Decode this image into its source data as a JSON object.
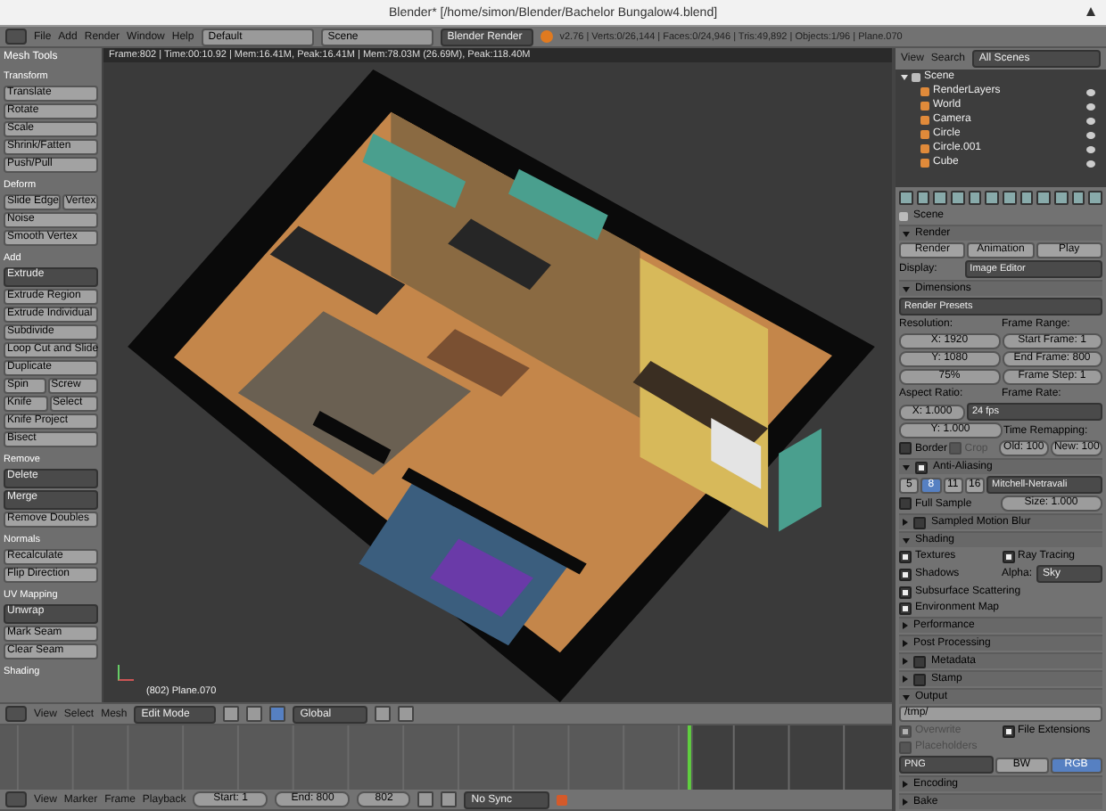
{
  "window": {
    "title": "Blender* [/home/simon/Blender/Bachelor Bungalow4.blend]"
  },
  "top_header": {
    "menus": [
      "File",
      "Add",
      "Render",
      "Window",
      "Help"
    ],
    "layout": "Default",
    "scene": "Scene",
    "engine": "Blender Render",
    "stats": "v2.76 | Verts:0/26,144 | Faces:0/24,946 | Tris:49,892 | Objects:1/96 | Plane.070"
  },
  "tool_shelf": {
    "title": "Mesh Tools",
    "sections": [
      {
        "title": "Transform",
        "rows": [
          [
            {
              "kind": "action",
              "text": "Translate"
            }
          ],
          [
            {
              "kind": "action",
              "text": "Rotate"
            }
          ],
          [
            {
              "kind": "action",
              "text": "Scale"
            }
          ],
          [
            {
              "kind": "action",
              "text": "Shrink/Fatten"
            }
          ],
          [
            {
              "kind": "action",
              "text": "Push/Pull"
            }
          ]
        ]
      },
      {
        "title": "Deform",
        "rows": [
          [
            {
              "kind": "action",
              "text": "Slide Edge"
            },
            {
              "kind": "action",
              "text": "Vertex"
            }
          ],
          [
            {
              "kind": "action",
              "text": "Noise"
            }
          ],
          [
            {
              "kind": "action",
              "text": "Smooth Vertex"
            }
          ]
        ]
      },
      {
        "title": "Add",
        "rows": [
          [
            {
              "kind": "dropdown",
              "text": "Extrude"
            }
          ],
          [
            {
              "kind": "action",
              "text": "Extrude Region"
            }
          ],
          [
            {
              "kind": "action",
              "text": "Extrude Individual"
            }
          ],
          [
            {
              "kind": "action",
              "text": "Subdivide"
            }
          ],
          [
            {
              "kind": "action",
              "text": "Loop Cut and Slide"
            }
          ],
          [
            {
              "kind": "action",
              "text": "Duplicate"
            }
          ],
          [
            {
              "kind": "action",
              "text": "Spin"
            },
            {
              "kind": "action",
              "text": "Screw"
            }
          ],
          [
            {
              "kind": "action",
              "text": "Knife"
            },
            {
              "kind": "action",
              "text": "Select"
            }
          ],
          [
            {
              "kind": "action",
              "text": "Knife Project"
            }
          ],
          [
            {
              "kind": "action",
              "text": "Bisect"
            }
          ]
        ]
      },
      {
        "title": "Remove",
        "rows": [
          [
            {
              "kind": "dropdown",
              "text": "Delete"
            }
          ],
          [
            {
              "kind": "dropdown",
              "text": "Merge"
            }
          ],
          [
            {
              "kind": "action",
              "text": "Remove Doubles"
            }
          ]
        ]
      },
      {
        "title": "Normals",
        "rows": [
          [
            {
              "kind": "action",
              "text": "Recalculate"
            }
          ],
          [
            {
              "kind": "action",
              "text": "Flip Direction"
            }
          ]
        ]
      },
      {
        "title": "UV Mapping",
        "rows": [
          [
            {
              "kind": "dropdown",
              "text": "Unwrap"
            }
          ],
          [
            {
              "kind": "action",
              "text": "Mark Seam"
            }
          ],
          [
            {
              "kind": "action",
              "text": "Clear Seam"
            }
          ]
        ]
      },
      {
        "title": "Shading"
      }
    ]
  },
  "viewport": {
    "info": "Frame:802 | Time:00:10.92 | Mem:16.41M, Peak:16.41M | Mem:78.03M (26.69M), Peak:118.40M",
    "object_label": "(802) Plane.070"
  },
  "view_header": {
    "menus": [
      "View",
      "Select",
      "Mesh"
    ],
    "mode": "Edit Mode",
    "orientation": "Global"
  },
  "timeline_footer": {
    "menus": [
      "View",
      "Marker",
      "Frame",
      "Playback"
    ],
    "start": "Start: 1",
    "end": "End: 800",
    "current": "802",
    "sync": "No Sync"
  },
  "outliner": {
    "menus": [
      "View",
      "Search"
    ],
    "filter": "All Scenes",
    "tree": [
      {
        "name": "Scene",
        "expanded": true,
        "children": [
          {
            "name": "RenderLayers"
          },
          {
            "name": "World"
          },
          {
            "name": "Camera"
          },
          {
            "name": "Circle"
          },
          {
            "name": "Circle.001"
          },
          {
            "name": "Cube"
          }
        ]
      }
    ]
  },
  "properties": {
    "breadcrumb": "Scene",
    "panels": [
      {
        "title": "Render",
        "expanded": true,
        "rows": [
          [
            {
              "kind": "toggle",
              "text": "Render",
              "selected": false
            },
            {
              "kind": "toggle",
              "text": "Animation",
              "selected": false
            },
            {
              "kind": "toggle",
              "text": "Play",
              "selected": false
            }
          ],
          [
            {
              "kind": "heading",
              "text": "Display:"
            },
            {
              "kind": "dropdown",
              "text": "Image Editor"
            }
          ]
        ]
      },
      {
        "title": "Dimensions",
        "expanded": true,
        "rows": [
          [
            {
              "kind": "dropdown",
              "text": "Render Presets"
            }
          ],
          [
            {
              "kind": "heading",
              "text": "Resolution:"
            },
            {
              "kind": "heading",
              "text": "Frame Range:"
            }
          ],
          [
            {
              "kind": "field",
              "text": "X: 1920"
            },
            {
              "kind": "field",
              "text": "Start Frame: 1"
            }
          ],
          [
            {
              "kind": "field",
              "text": "Y: 1080"
            },
            {
              "kind": "field",
              "text": "End Frame: 800"
            }
          ],
          [
            {
              "kind": "field",
              "text": "75%"
            },
            {
              "kind": "field",
              "text": "Frame Step: 1"
            }
          ],
          [
            {
              "kind": "heading",
              "text": "Aspect Ratio:"
            },
            {
              "kind": "heading",
              "text": "Frame Rate:"
            }
          ],
          [
            {
              "kind": "field",
              "text": "X: 1.000"
            },
            {
              "kind": "dropdown",
              "text": "24 fps"
            }
          ],
          [
            {
              "kind": "field",
              "text": "Y: 1.000"
            },
            {
              "kind": "heading",
              "text": "Time Remapping:"
            }
          ],
          [
            {
              "kind": "check",
              "text": "Border",
              "checked": false,
              "disabled": false
            },
            {
              "kind": "check",
              "text": "Crop",
              "checked": false,
              "disabled": true
            },
            {
              "kind": "field",
              "text": "Old: 100"
            },
            {
              "kind": "field",
              "text": "New: 100"
            }
          ]
        ]
      },
      {
        "title": "Anti-Aliasing",
        "expanded": true,
        "checked": true,
        "rows": [
          [
            {
              "kind": "samples",
              "options": [
                {
                  "text": "5",
                  "selected": false
                },
                {
                  "text": "8",
                  "selected": true
                },
                {
                  "text": "11",
                  "selected": false
                },
                {
                  "text": "16",
                  "selected": false
                }
              ]
            },
            {
              "kind": "dropdown",
              "text": "Mitchell-Netravali"
            }
          ],
          [
            {
              "kind": "check",
              "text": "Full Sample",
              "checked": false,
              "disabled": false
            },
            {
              "kind": "field",
              "text": "Size: 1.000"
            }
          ]
        ]
      },
      {
        "title": "Sampled Motion Blur",
        "expanded": false,
        "checked": false
      },
      {
        "title": "Shading",
        "expanded": true,
        "rows": [
          [
            {
              "kind": "check",
              "text": "Textures",
              "checked": true,
              "disabled": false
            },
            {
              "kind": "check",
              "text": "Ray Tracing",
              "checked": true,
              "disabled": false
            }
          ],
          [
            {
              "kind": "check",
              "text": "Shadows",
              "checked": true,
              "disabled": false
            },
            {
              "kind": "labeled_dropdown",
              "label": "Alpha:",
              "text": "Sky"
            }
          ],
          [
            {
              "kind": "check",
              "text": "Subsurface Scattering",
              "checked": true,
              "disabled": false
            }
          ],
          [
            {
              "kind": "check",
              "text": "Environment Map",
              "checked": true,
              "disabled": false
            }
          ]
        ]
      },
      {
        "title": "Performance",
        "expanded": false
      },
      {
        "title": "Post Processing",
        "expanded": false
      },
      {
        "title": "Metadata",
        "expanded": false,
        "checked": false
      },
      {
        "title": "Stamp",
        "expanded": false,
        "checked": false
      },
      {
        "title": "Output",
        "expanded": true,
        "rows": [
          [
            {
              "kind": "path",
              "text": "/tmp/"
            }
          ],
          [
            {
              "kind": "check",
              "text": "Overwrite",
              "checked": true,
              "disabled": true
            },
            {
              "kind": "check",
              "text": "File Extensions",
              "checked": true,
              "disabled": false
            }
          ],
          [
            {
              "kind": "check",
              "text": "Placeholders",
              "checked": false,
              "disabled": true
            }
          ],
          [
            {
              "kind": "dropdown",
              "text": "PNG"
            },
            {
              "kind": "toggle",
              "text": "BW",
              "selected": false
            },
            {
              "kind": "toggle",
              "text": "RGB",
              "selected": true
            }
          ]
        ]
      },
      {
        "title": "Encoding",
        "expanded": false
      },
      {
        "title": "Bake",
        "expanded": false
      }
    ]
  }
}
